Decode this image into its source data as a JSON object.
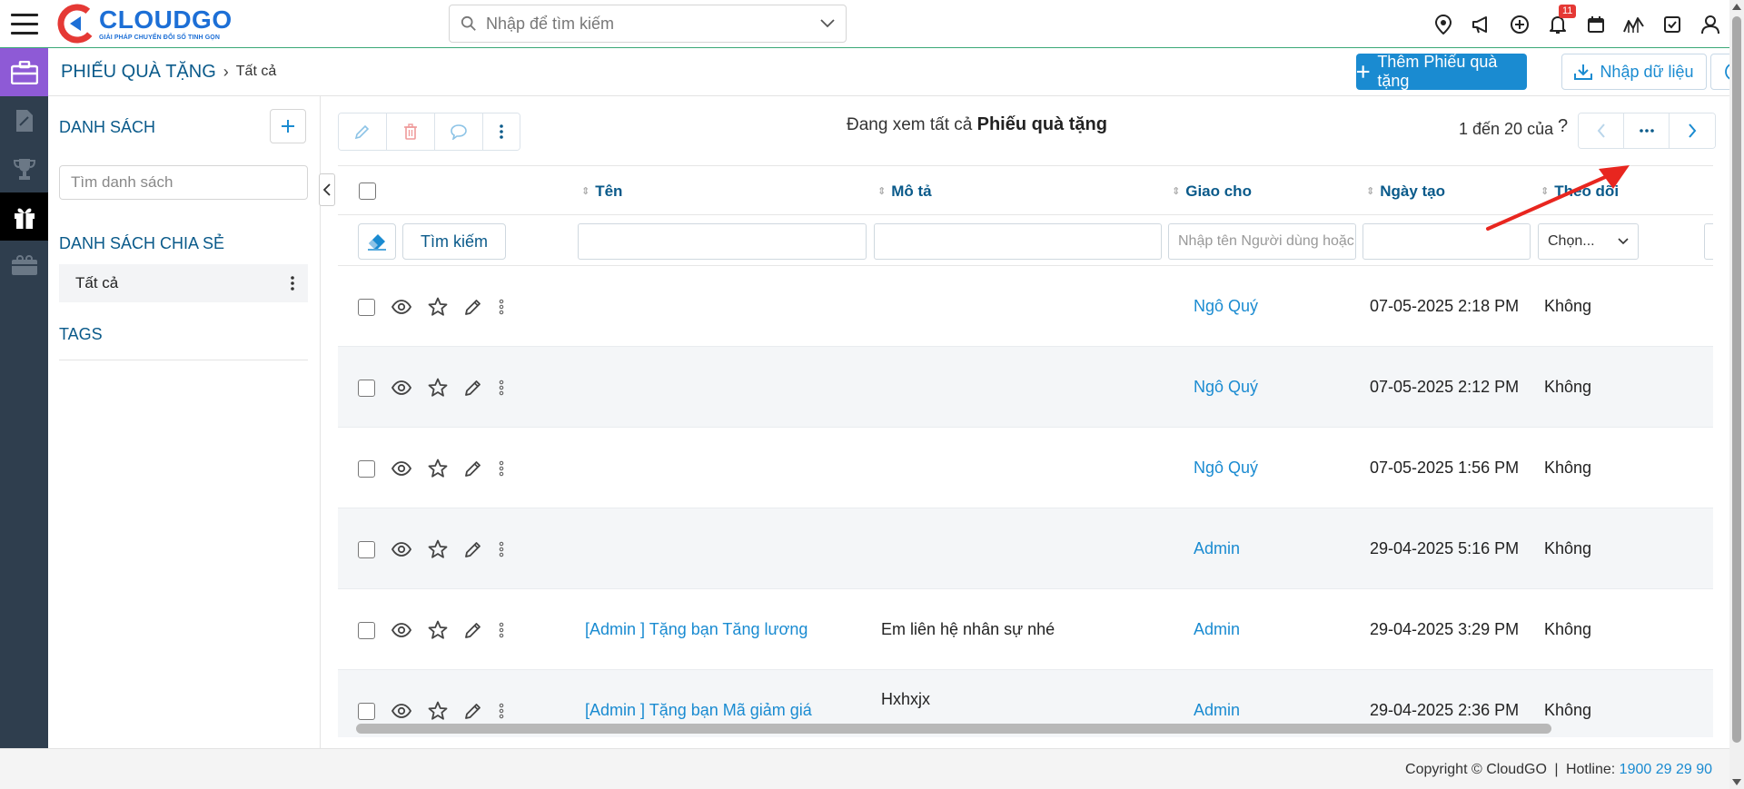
{
  "header": {
    "brand": "CLOUDGO",
    "brand_tagline": "GIẢI PHÁP CHUYỂN ĐỔI SỐ TINH GỌN",
    "search_placeholder": "Nhập để tìm kiếm",
    "notification_count": "11",
    "icons": [
      "location-pin-icon",
      "megaphone-icon",
      "plus-circle-icon",
      "bell-icon",
      "calendar-icon",
      "chart-icon",
      "checkbox-icon",
      "user-icon"
    ]
  },
  "rail": {
    "items": [
      "briefcase-icon",
      "document-icon",
      "trophy-icon",
      "gift-icon",
      "gift-box-icon"
    ]
  },
  "breadcrumb": {
    "module": "PHIẾU QUÀ TẶNG",
    "current": "Tất cả"
  },
  "actions": {
    "add_label": "Thêm Phiếu quà tặng",
    "import_label": "Nhập dữ liệu"
  },
  "list_panel": {
    "title": "DANH SÁCH",
    "search_placeholder": "Tìm danh sách",
    "shared_title": "DANH SÁCH CHIA SẺ",
    "shared_items": [
      "Tất cả"
    ],
    "tags_title": "TAGS"
  },
  "main": {
    "viewing_prefix": "Đang xem tất cả",
    "viewing_module": "Phiếu quà tặng",
    "pager_text": "1 đến 20 của",
    "pager_q": "?"
  },
  "table": {
    "columns": [
      "Tên",
      "Mô tả",
      "Giao cho",
      "Ngày tạo",
      "Theo dõi"
    ],
    "filter": {
      "search_label": "Tìm kiếm",
      "assignee_placeholder": "Nhập tên Người dùng hoặc",
      "follow_placeholder": "Chọn..."
    },
    "rows": [
      {
        "name": "",
        "desc": "",
        "assignee": "Ngô Quý",
        "created": "07-05-2025 2:18 PM",
        "follow": "Không"
      },
      {
        "name": "",
        "desc": "",
        "assignee": "Ngô Quý",
        "created": "07-05-2025 2:12 PM",
        "follow": "Không"
      },
      {
        "name": "",
        "desc": "",
        "assignee": "Ngô Quý",
        "created": "07-05-2025 1:56 PM",
        "follow": "Không"
      },
      {
        "name": "",
        "desc": "",
        "assignee": "Admin",
        "created": "29-04-2025 5:16 PM",
        "follow": "Không"
      },
      {
        "name": "[Admin ] Tặng bạn Tăng lương",
        "desc": "Em liên hệ nhân sự nhé",
        "assignee": "Admin",
        "created": "29-04-2025 3:29 PM",
        "follow": "Không"
      },
      {
        "name": "[Admin ] Tặng bạn Mã giảm giá",
        "desc": "Hxhxjx",
        "assignee": "Admin",
        "created": "29-04-2025 2:36 PM",
        "follow": "Không"
      }
    ]
  },
  "footer": {
    "copyright": "Copyright © CloudGO",
    "hotline_label": "Hotline:",
    "hotline": "1900 29 29 90"
  },
  "colors": {
    "primary": "#1a8bd1",
    "heading": "#0a5a8a",
    "rail": "#2f3e4e",
    "rail_active": "#8e5ad6",
    "annotation": "#e8261f"
  }
}
